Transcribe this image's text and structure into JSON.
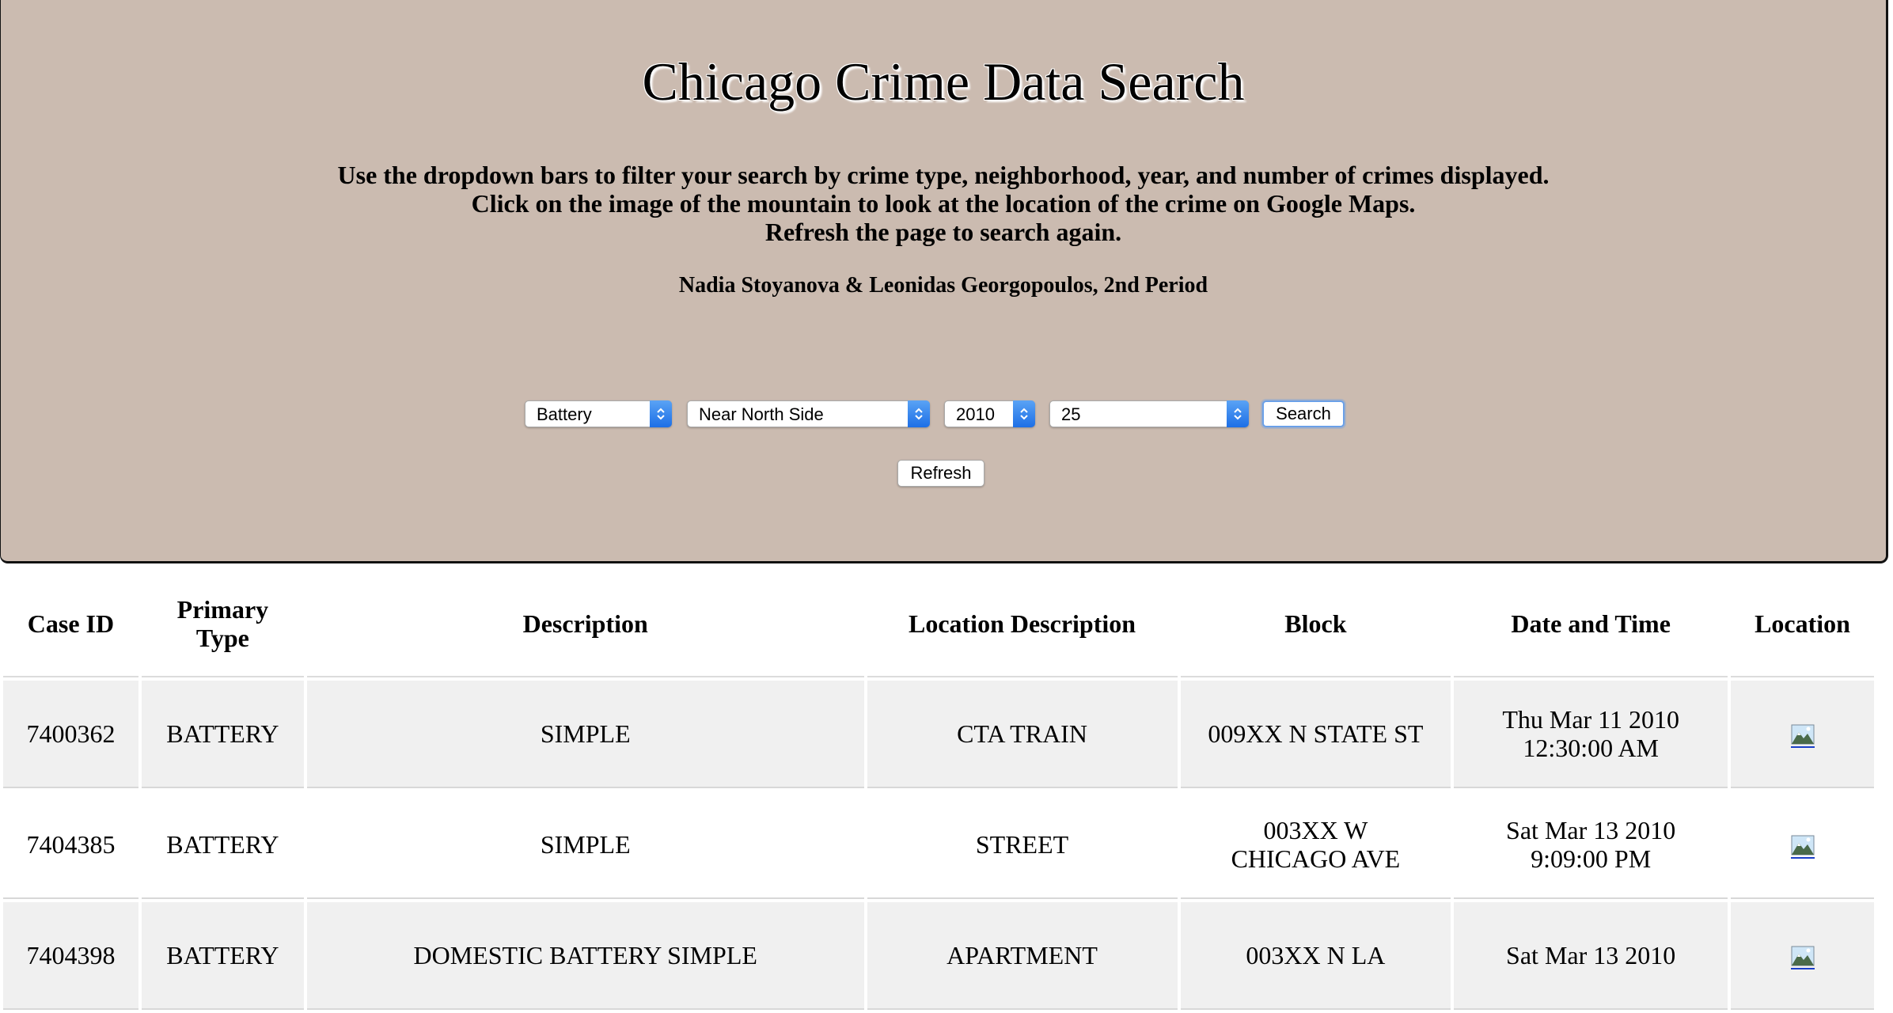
{
  "header": {
    "title": "Chicago Crime Data Search",
    "instructions": [
      "Use the dropdown bars to filter your search by crime type, neighborhood, year, and number of crimes displayed.",
      "Click on the image of the mountain to look at the location of the crime on Google Maps.",
      "Refresh the page to search again."
    ],
    "authors": "Nadia Stoyanova & Leonidas Georgopoulos, 2nd Period"
  },
  "filters": {
    "crime_type": "Battery",
    "neighborhood": "Near North Side",
    "year": "2010",
    "count": "25",
    "search_label": "Search",
    "refresh_label": "Refresh"
  },
  "colors": {
    "header_bg": "#cbbbb0",
    "select_arrow": "#1d6fe6",
    "link": "#1a3ec8"
  },
  "table": {
    "headers": {
      "case_id": "Case ID",
      "primary_type_line1": "Primary",
      "primary_type_line2": "Type",
      "description": "Description",
      "location_description": "Location Description",
      "block": "Block",
      "date_time": "Date and Time",
      "location": "Location"
    },
    "rows": [
      {
        "case_id": "7400362",
        "primary_type": "BATTERY",
        "description": "SIMPLE",
        "location_description": "CTA TRAIN",
        "block_line1": "009XX N STATE ST",
        "block_line2": "",
        "date_line1": "Thu Mar 11 2010",
        "date_line2": "12:30:00 AM",
        "location_icon": "mountain-image-icon"
      },
      {
        "case_id": "7404385",
        "primary_type": "BATTERY",
        "description": "SIMPLE",
        "location_description": "STREET",
        "block_line1": "003XX W",
        "block_line2": "CHICAGO AVE",
        "date_line1": "Sat Mar 13 2010",
        "date_line2": "9:09:00 PM",
        "location_icon": "mountain-image-icon"
      },
      {
        "case_id": "7404398",
        "primary_type": "BATTERY",
        "description": "DOMESTIC BATTERY SIMPLE",
        "location_description": "APARTMENT",
        "block_line1": "003XX N LA",
        "block_line2": "",
        "date_line1": "Sat Mar 13 2010",
        "date_line2": "",
        "location_icon": "mountain-image-icon"
      }
    ]
  }
}
